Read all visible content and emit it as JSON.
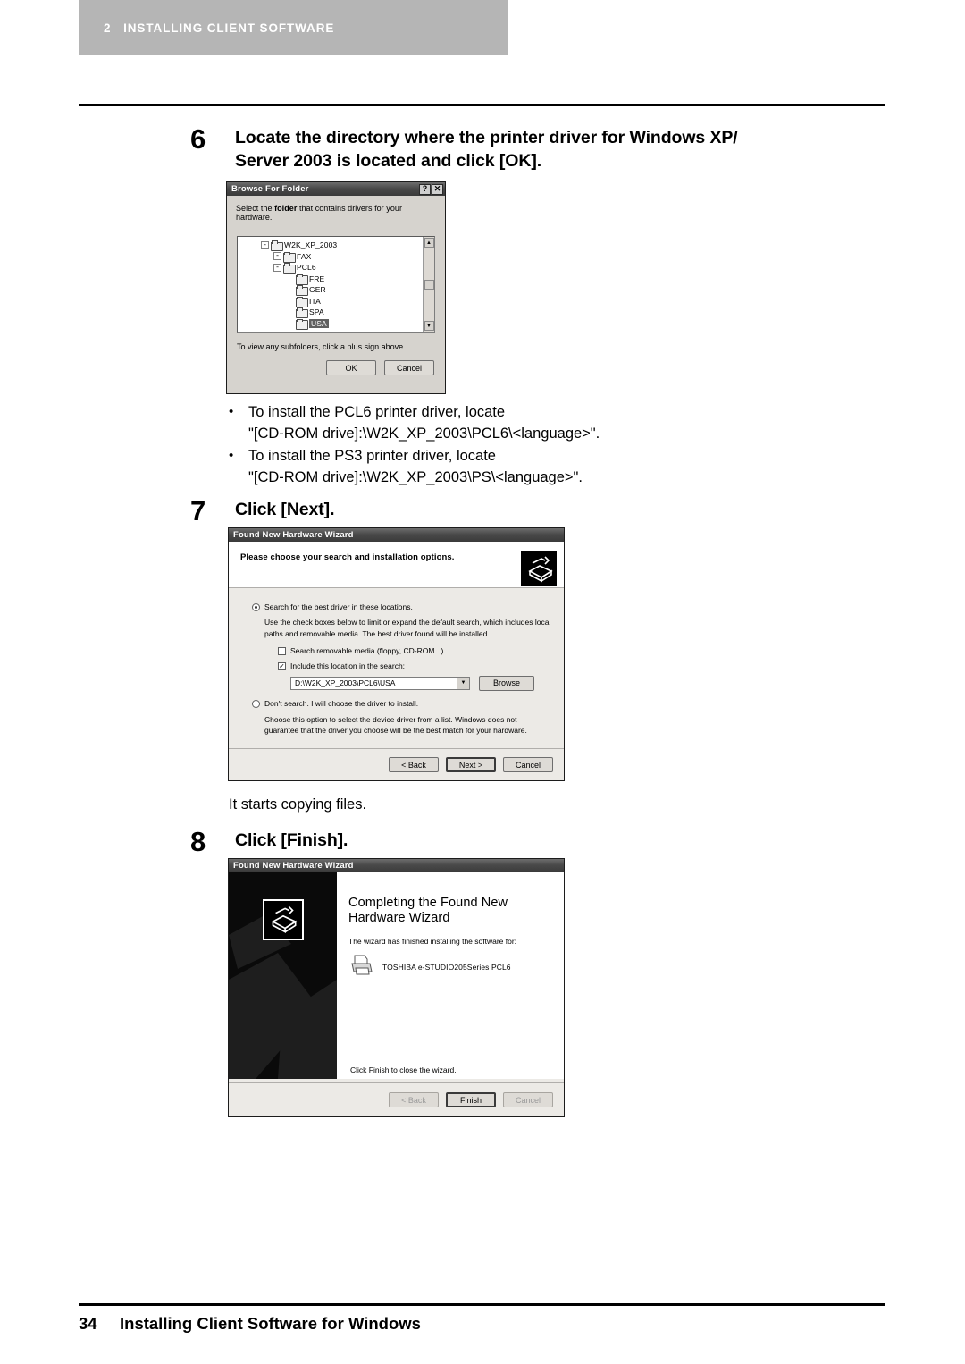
{
  "running_head": {
    "chapter_number": "2",
    "chapter_title": "INSTALLING CLIENT SOFTWARE"
  },
  "steps": [
    {
      "number": "6",
      "title": "Locate the directory where the printer driver for Windows XP/\nServer 2003 is located and click [OK]."
    },
    {
      "number": "7",
      "title": "Click [Next]."
    },
    {
      "number": "8",
      "title": "Click [Finish]."
    }
  ],
  "bullets": [
    {
      "line1": "To install the PCL6 printer driver, locate",
      "line2": "\"[CD-ROM drive]:\\W2K_XP_2003\\PCL6\\<language>\"."
    },
    {
      "line1": "To install the PS3 printer driver, locate",
      "line2": "\"[CD-ROM drive]:\\W2K_XP_2003\\PS\\<language>\"."
    }
  ],
  "note_after_step7": "It starts copying files.",
  "browse_dialog": {
    "title": "Browse For Folder",
    "help_button": "?",
    "close_button": "✕",
    "prompt_pre": "Select the ",
    "prompt_bold": "folder",
    "prompt_post": " that contains drivers for your hardware.",
    "tree": [
      {
        "indent": 0,
        "expander": "-",
        "label": "W2K_XP_2003",
        "selected": false
      },
      {
        "indent": 1,
        "expander": "-",
        "label": "FAX",
        "selected": false
      },
      {
        "indent": 1,
        "expander": "-",
        "label": "PCL6",
        "selected": false
      },
      {
        "indent": 2,
        "expander": "",
        "label": "FRE",
        "selected": false
      },
      {
        "indent": 2,
        "expander": "",
        "label": "GER",
        "selected": false
      },
      {
        "indent": 2,
        "expander": "",
        "label": "ITA",
        "selected": false
      },
      {
        "indent": 2,
        "expander": "",
        "label": "SPA",
        "selected": false
      },
      {
        "indent": 2,
        "expander": "",
        "label": "USA",
        "selected": true
      }
    ],
    "scroll_up": "▲",
    "scroll_down": "▼",
    "footer_hint": "To view any subfolders, click a plus sign above.",
    "ok_button": "OK",
    "cancel_button": "Cancel"
  },
  "wizard_search": {
    "title": "Found New Hardware Wizard",
    "header_title": "Please choose your search and installation options.",
    "radio_search_label": "Search for the best driver in these locations.",
    "radio_search_selected": true,
    "search_help": "Use the check boxes below to limit or expand the default search, which includes local paths and removable media. The best driver found will be installed.",
    "checkbox_removable_label": "Search removable media (floppy, CD-ROM...)",
    "checkbox_removable_checked": false,
    "checkbox_location_label": "Include this location in the search:",
    "checkbox_location_checked": true,
    "checkbox_mark": "✓",
    "location_value": "D:\\W2K_XP_2003\\PCL6\\USA",
    "combo_arrow": "▼",
    "browse_button": "Browse",
    "radio_dontsearch_label": "Don't search. I will choose the driver to install.",
    "radio_dontsearch_selected": false,
    "dontsearch_help": "Choose this option to select the device driver from a list.  Windows does not guarantee that the driver you choose will be the best match for your hardware.",
    "back_button": "< Back",
    "next_button": "Next >",
    "cancel_button": "Cancel"
  },
  "wizard_finish": {
    "title": "Found New Hardware Wizard",
    "heading": "Completing the Found New Hardware Wizard",
    "subtext": "The wizard has finished installing the software for:",
    "device_name": "TOSHIBA e-STUDIO205Series PCL6",
    "close_hint": "Click Finish to close the wizard.",
    "back_button": "< Back",
    "finish_button": "Finish",
    "cancel_button": "Cancel"
  },
  "footer": {
    "page_number": "34",
    "text": "Installing Client Software for Windows"
  },
  "colors": {
    "runhead_bg": "#b5b5b5",
    "runhead_fg": "#ffffff",
    "rule": "#000000",
    "dialog_face": "#d6d3ce",
    "selection": "#606060"
  }
}
